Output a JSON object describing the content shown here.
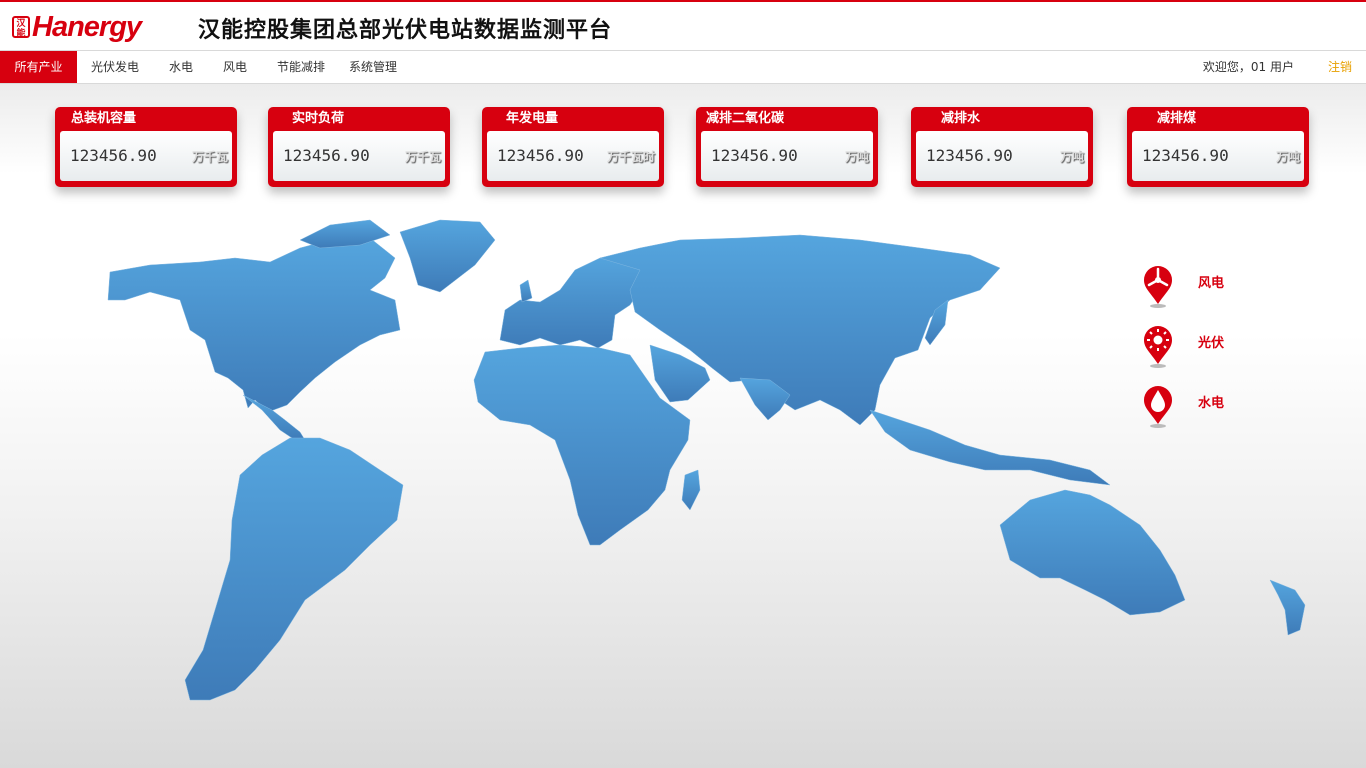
{
  "header": {
    "logo_seal": "汉能",
    "logo_text": "Hanergy",
    "title": "汉能控股集团总部光伏电站数据监测平台"
  },
  "nav": {
    "items": [
      "所有产业",
      "光伏发电",
      "水电",
      "风电",
      "节能减排",
      "系统管理"
    ],
    "active": "所有产业",
    "welcome": "欢迎您，01 用户",
    "logout": "注销"
  },
  "cards": [
    {
      "title": "总装机容量",
      "value": "123456.90",
      "unit": "万千瓦"
    },
    {
      "title": "实时负荷",
      "value": "123456.90",
      "unit": "万千瓦"
    },
    {
      "title": "年发电量",
      "value": "123456.90",
      "unit": "万千瓦时"
    },
    {
      "title": "减排二氧化碳",
      "value": "123456.90",
      "unit": "万吨"
    },
    {
      "title": "减排水",
      "value": "123456.90",
      "unit": "万吨"
    },
    {
      "title": "减排煤",
      "value": "123456.90",
      "unit": "万吨"
    }
  ],
  "legend": [
    {
      "label": "风电",
      "icon": "wind-turbine-icon"
    },
    {
      "label": "光伏",
      "icon": "sun-icon"
    },
    {
      "label": "水电",
      "icon": "water-drop-icon"
    }
  ],
  "colors": {
    "brand_red": "#d7000f",
    "map_blue": "#4a94cf",
    "logout": "#e8a000"
  }
}
